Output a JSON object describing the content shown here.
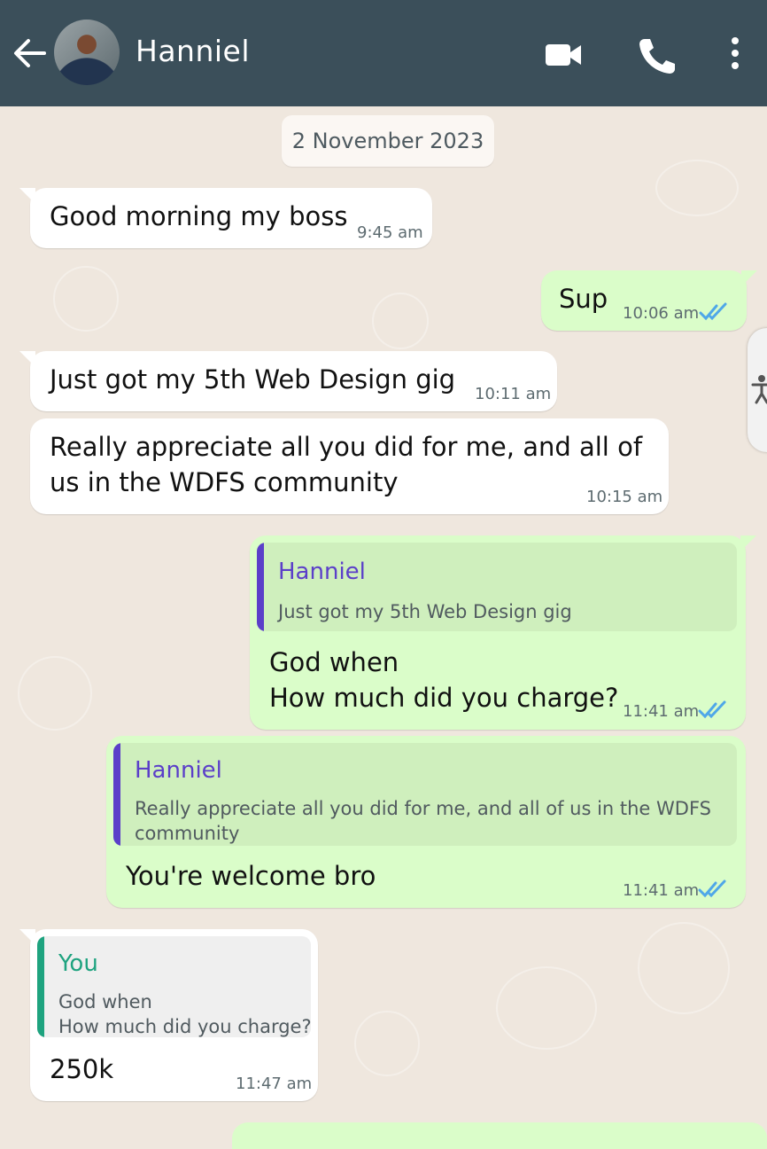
{
  "header": {
    "contact_name": "Hanniel",
    "icons": [
      "back-arrow-icon",
      "video-call-icon",
      "phone-icon",
      "more-options-icon"
    ],
    "background_color": "#3b4f5a"
  },
  "chat": {
    "date_label": "2 November 2023",
    "messages": [
      {
        "direction": "in",
        "text": "Good morning my boss",
        "time": "9:45 am"
      },
      {
        "direction": "out",
        "text": "Sup",
        "time": "10:06 am",
        "status": "read"
      },
      {
        "direction": "in",
        "text": "Just got my 5th Web Design gig",
        "time": "10:11 am"
      },
      {
        "direction": "in",
        "text_line1": "Really appreciate all you did for me, and all of",
        "text_line2": "us in the WDFS community",
        "time": "10:15 am"
      },
      {
        "direction": "out",
        "quote_name": "Hanniel",
        "quote_text": "Just got my 5th Web Design gig",
        "text_line1": "God when",
        "text_line2": "How much did you charge?",
        "time": "11:41 am",
        "status": "read"
      },
      {
        "direction": "out",
        "quote_name": "Hanniel",
        "quote_text_line1": "Really appreciate all you did for me, and all of us in the WDFS",
        "quote_text_line2": "community",
        "text": "You're welcome bro",
        "time": "11:41 am",
        "status": "read"
      },
      {
        "direction": "in",
        "quote_name": "You",
        "quote_text_line1": "God when",
        "quote_text_line2": "How much did you charge?",
        "text": "250k",
        "time": "11:47 am"
      }
    ]
  },
  "colors": {
    "incoming_bubble": "#ffffff",
    "outgoing_bubble": "#dafdc9",
    "read_ticks": "#4fa7e8",
    "quote_purple": "#5b3fc9",
    "quote_teal": "#1ea37f",
    "chat_background": "#efe7de"
  }
}
